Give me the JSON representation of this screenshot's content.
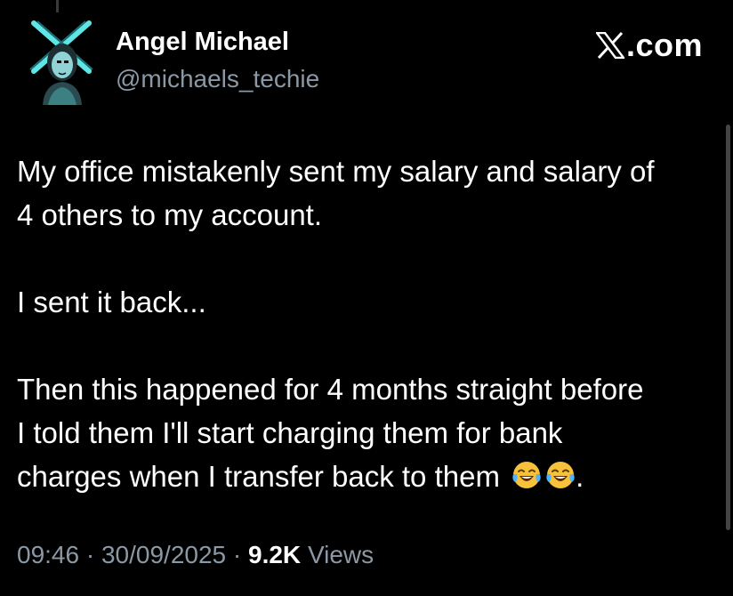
{
  "author": {
    "display_name": "Angel Michael",
    "handle": "@michaels_techie",
    "avatar_icon": "avatar-crossed-swords-portrait-icon"
  },
  "brand": {
    "icon": "x-logo-icon",
    "suffix": ".com"
  },
  "tweet": {
    "line_1": "My office mistakenly sent my salary and salary of",
    "line_2": "4 others to my account.",
    "line_3": "I sent it back...",
    "line_4": "Then this happened for 4 months straight before",
    "line_5": "I told them I'll start charging them for bank",
    "line_6": "charges when I transfer back to them",
    "line_6_end": ".",
    "emojis": [
      "face-with-tears-of-joy-icon",
      "face-with-tears-of-joy-icon"
    ]
  },
  "meta": {
    "time": "09:46",
    "separator": "·",
    "date": "30/09/2025",
    "views_count": "9.2K",
    "views_label": "Views"
  },
  "colors": {
    "background": "#000000",
    "text_primary": "#ffffff",
    "text_secondary": "#8b98a5",
    "avatar_accent": "#5ee6e6"
  }
}
